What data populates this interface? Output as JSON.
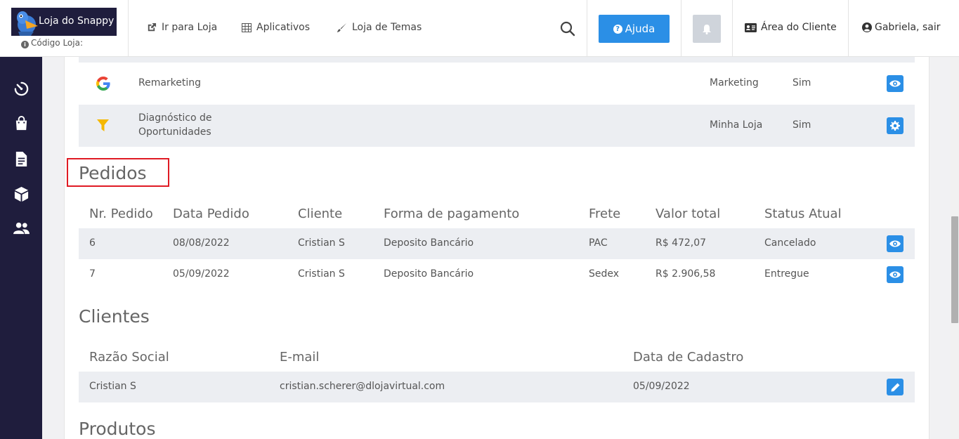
{
  "header": {
    "logo_text": "Loja do Snappy",
    "store_code_label": "Código Loja:",
    "nav": [
      {
        "label": "Ir para Loja",
        "icon": "external-link-icon"
      },
      {
        "label": "Aplicativos",
        "icon": "grid-icon"
      },
      {
        "label": "Loja de Temas",
        "icon": "brush-icon"
      }
    ],
    "help_label": "Ajuda",
    "client_area_label": "Área do Cliente",
    "user_label": "Gabriela, sair"
  },
  "sidebar": {
    "icons": [
      "timer-icon",
      "shopping-bag-icon",
      "document-icon",
      "box-icon",
      "users-icon"
    ]
  },
  "apps": [
    {
      "name": "Remarketing",
      "category": "Marketing",
      "active": "Sim",
      "icon": "google-icon",
      "action": "eye-icon"
    },
    {
      "name_line1": "Diagnóstico de",
      "name_line2": "Oportunidades",
      "category": "Minha Loja",
      "active": "Sim",
      "icon": "funnel-icon",
      "action": "gear-icon"
    }
  ],
  "orders": {
    "title": "Pedidos",
    "headers": [
      "Nr. Pedido",
      "Data Pedido",
      "Cliente",
      "Forma de pagamento",
      "Frete",
      "Valor total",
      "Status Atual"
    ],
    "rows": [
      [
        "6",
        "08/08/2022",
        "Cristian S",
        "Deposito Bancário",
        "PAC",
        "R$ 472,07",
        "Cancelado"
      ],
      [
        "7",
        "05/09/2022",
        "Cristian S",
        "Deposito Bancário",
        "Sedex",
        "R$ 2.906,58",
        "Entregue"
      ]
    ]
  },
  "clients": {
    "title": "Clientes",
    "headers": [
      "Razão Social",
      "E-mail",
      "Data de Cadastro"
    ],
    "rows": [
      [
        "Cristian S",
        "cristian.scherer@dlojavirtual.com",
        "05/09/2022"
      ]
    ]
  },
  "products": {
    "title": "Produtos"
  },
  "colors": {
    "accent": "#2b8fe6",
    "sidebar": "#1f1d3d",
    "highlight": "#e01b24"
  }
}
